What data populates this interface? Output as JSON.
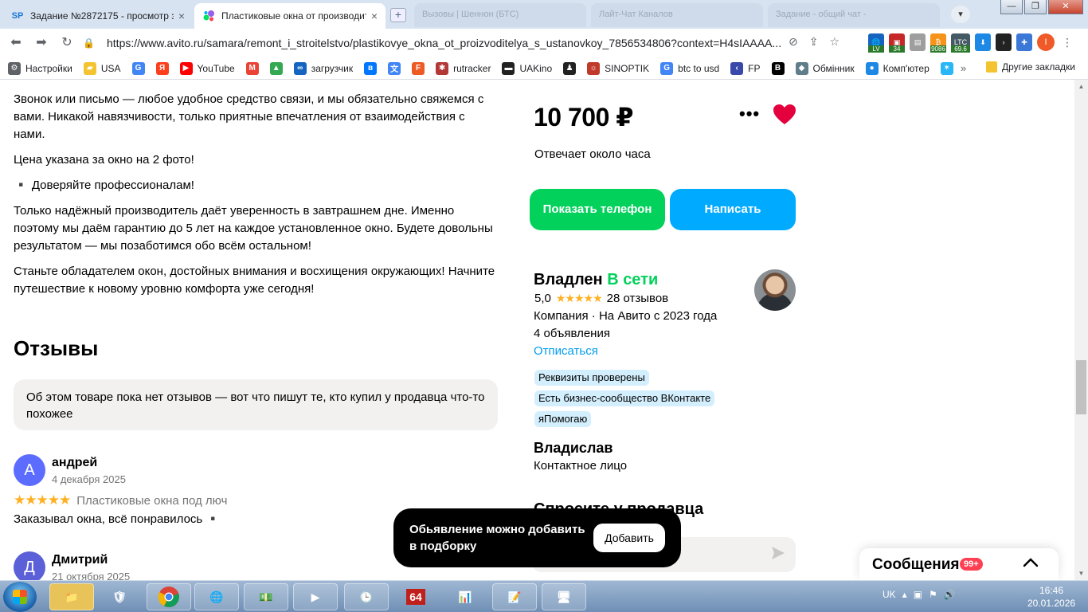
{
  "browser": {
    "tabs": [
      {
        "favicon": "SP",
        "title": "Задание №2872175 - просмотр з",
        "active": false
      },
      {
        "favicon": "avito-logo",
        "title": "Пластиковые окна от производит",
        "active": true
      }
    ],
    "background_tabs": [
      "Вызовы | Шеннон (БТС)",
      "Лайт-Чат Каналов",
      "Задание - общий чат -"
    ],
    "url": "https://www.avito.ru/samara/remont_i_stroitelstvo/plastikovye_okna_ot_proizvoditelya_s_ustanovkoy_7856534806?context=H4sIAAAA...",
    "extensions": [
      {
        "label": "LV",
        "color": "#1565c0"
      },
      {
        "label": "34",
        "color": "#c62828"
      },
      {
        "label": "BTC",
        "color": "#f7931a"
      },
      {
        "label": "9086",
        "color": "#f7931a"
      },
      {
        "label": "LTC",
        "color": "#455a64"
      },
      {
        "label": "69.6",
        "color": "#455a64"
      }
    ],
    "profile_initial": "I",
    "bookmarks": [
      {
        "label": "Настройки",
        "icon": "gear-icon",
        "color": "#5f6368"
      },
      {
        "label": "USA",
        "icon": "folder-icon",
        "color": "#f4c430"
      },
      {
        "label": "",
        "icon": "google-icon",
        "color": "#4285f4"
      },
      {
        "label": "",
        "icon": "yandex-icon",
        "color": "#fc3f1d"
      },
      {
        "label": "YouTube",
        "icon": "youtube-icon",
        "color": "#ff0000"
      },
      {
        "label": "",
        "icon": "gmail-icon",
        "color": "#ea4335"
      },
      {
        "label": "",
        "icon": "drive-icon",
        "color": "#34a853"
      },
      {
        "label": "загрузчик",
        "icon": "download-icon",
        "color": "#1565c0"
      },
      {
        "label": "",
        "icon": "vk-icon",
        "color": "#0077ff"
      },
      {
        "label": "",
        "icon": "translate-icon",
        "color": "#4285f4"
      },
      {
        "label": "",
        "icon": "f-icon",
        "color": "#ee5a24"
      },
      {
        "label": "rutracker",
        "icon": "rutracker-icon",
        "color": "#b33939"
      },
      {
        "label": "UAKino",
        "icon": "uakino-icon",
        "color": "#222222"
      },
      {
        "label": "",
        "icon": "figure-icon",
        "color": "#222222"
      },
      {
        "label": "SINOPTIK",
        "icon": "weather-icon",
        "color": "#c0392b"
      },
      {
        "label": "btc to usd",
        "icon": "google-icon",
        "color": "#4285f4"
      },
      {
        "label": "FP",
        "icon": "fp-icon",
        "color": "#3949ab"
      },
      {
        "label": "",
        "icon": "bc-icon",
        "color": "#000000"
      },
      {
        "label": "Обмінник",
        "icon": "exchange-icon",
        "color": "#607d8b"
      },
      {
        "label": "Комп'ютер",
        "icon": "computer-icon",
        "color": "#1e88e5"
      },
      {
        "label": "",
        "icon": "star-icon",
        "color": "#29b6f6"
      }
    ],
    "bookmarks_more": "»",
    "other_bookmarks": "Другие закладки"
  },
  "description": [
    "Звонок или письмо — любое удобное средство связи, и мы обязательно свяжемся с вами. Никакой навязчивости, только приятные впечатления от взаимодействия с нами.",
    "Цена указана за окно на 2 фото!",
    "▪️ Доверяйте профессионалам!",
    "Только надёжный производитель даёт уверенность в завтрашнем дне. Именно поэтому мы даём гарантию до 5 лет на каждое установленное окно. Будете довольны результатом — мы позаботимся обо всём остальном!",
    "Станьте обладателем окон, достойных внимания и восхищения окружающих! Начните путешествие к новому уровню комфорта уже сегодня!"
  ],
  "reviews": {
    "title": "Отзывы",
    "note": "Об этом товаре пока нет отзывов — вот что пишут те, кто купил у продавца что-то похожее",
    "items": [
      {
        "initial": "А",
        "name": "андрей",
        "date": "4 декабря 2025",
        "stars": "★★★★★",
        "product": "Пластиковые окна под люч",
        "text": "Заказывал окна, всё понравилось ▪️",
        "color": "#5b6cff"
      },
      {
        "initial": "Д",
        "name": "Дмитрий",
        "date": "21 октября 2025",
        "stars": "",
        "product": "",
        "text": "",
        "color": "#5b5fd8"
      }
    ]
  },
  "listing": {
    "price": "10 700 ₽",
    "more": "•••",
    "reply_time": "Отвечает около часа",
    "show_phone": "Показать телефон",
    "write": "Написать"
  },
  "seller": {
    "name": "Владлен",
    "status": "В сети",
    "rating": "5,0",
    "stars": "★★★★★",
    "reviews_count": "28 отзывов",
    "type": "Компания · На Авито с 2023 года",
    "listings": "4 объявления",
    "unsubscribe": "Отписаться",
    "badges": [
      "Реквизиты проверены",
      "Есть бизнес-сообщество ВКонтакте",
      "яПомогаю"
    ],
    "contact_name": "Владислав",
    "contact_role": "Контактное лицо",
    "ask_title": "Спросите у продавца"
  },
  "toast": {
    "text": "Обьявление можно добавить в подборку",
    "button": "Добавить"
  },
  "messages": {
    "label": "Сообщения",
    "count": "99+"
  },
  "taskbar": {
    "lang": "UK",
    "time": "16:46",
    "date": "20.01.2026",
    "badge_64": "64"
  },
  "colors": {
    "green": "#02d15c",
    "blue": "#00aaff",
    "link": "#009cf0",
    "heart": "#e4003d",
    "star": "#ffb021"
  }
}
